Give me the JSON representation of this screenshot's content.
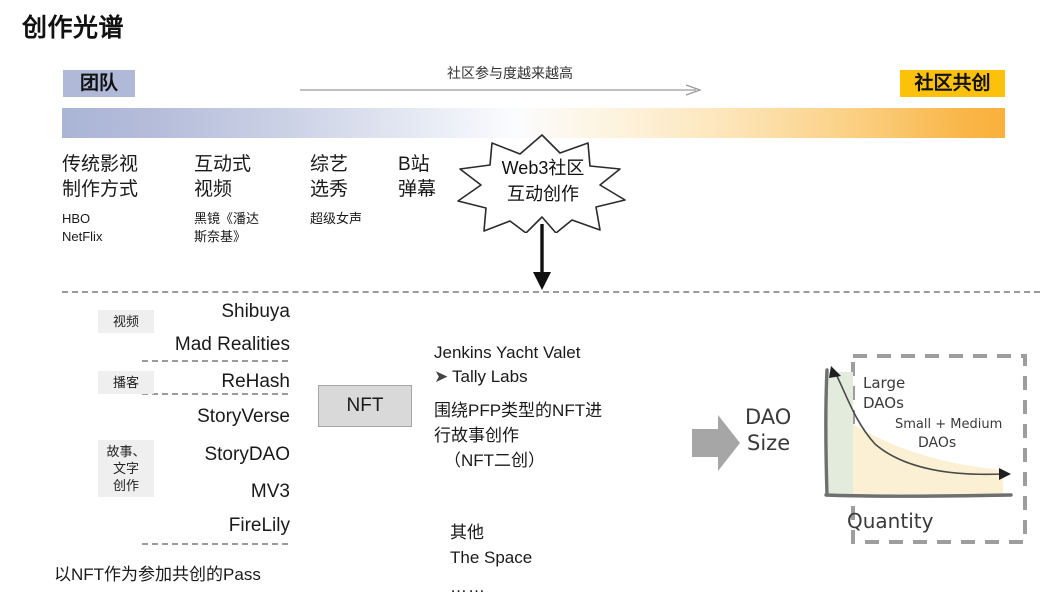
{
  "slide": {
    "title": "创作光谱"
  },
  "spectrum": {
    "left_badge": "团队",
    "right_badge": "社区共创",
    "axis_label": "社区参与度越来越高",
    "left_color": "#aab4d6",
    "right_color": "#f9b13c",
    "left_badge_color": "#b0bad8",
    "right_badge_color": "#fcc20b"
  },
  "stages": [
    {
      "title_line1": "传统影视",
      "title_line2": "制作方式",
      "examples": "HBO\nNetFlix"
    },
    {
      "title_line1": "互动式",
      "title_line2": "视频",
      "examples": "黑镜《潘达\n斯奈基》"
    },
    {
      "title_line1": "综艺",
      "title_line2": "选秀",
      "examples": "超级女声"
    },
    {
      "title_line1": "B站",
      "title_line2": "弹幕",
      "examples": ""
    }
  ],
  "starburst": {
    "line1": "Web3社区",
    "line2": "互动创作"
  },
  "left_list": {
    "tags": [
      {
        "label": "视频"
      },
      {
        "label": "播客"
      },
      {
        "label": "故事、\n文字\n创作"
      }
    ],
    "projects": [
      "Shibuya",
      "Mad Realities",
      "ReHash",
      "StoryVerse",
      "StoryDAO",
      "MV3",
      "FireLily"
    ],
    "footnote": "以NFT作为参加共创的Pass"
  },
  "nft": {
    "box_label": "NFT",
    "project_title": "Jenkins Yacht Valet",
    "bullet": "Tally Labs",
    "description_line1": "围绕PFP类型的NFT进",
    "description_line2": "行故事创作",
    "description_line3": "（NFT二创）",
    "other_label": "其他",
    "other_item": "The Space",
    "other_ellipsis": "……"
  },
  "dao_chart": {
    "caption": "DAO\nSize",
    "caption_line1": "DAO",
    "caption_line2": "Size",
    "y_axis_label": "DAO Size",
    "x_axis_label": "Quantity",
    "region_large_line1": "Large",
    "region_large_line2": "DAOs",
    "region_small_line1": "Small + Medium",
    "region_small_line2": "DAOs",
    "large_fill_color": "#e3ebdd",
    "small_fill_color": "#fbf0d3"
  }
}
